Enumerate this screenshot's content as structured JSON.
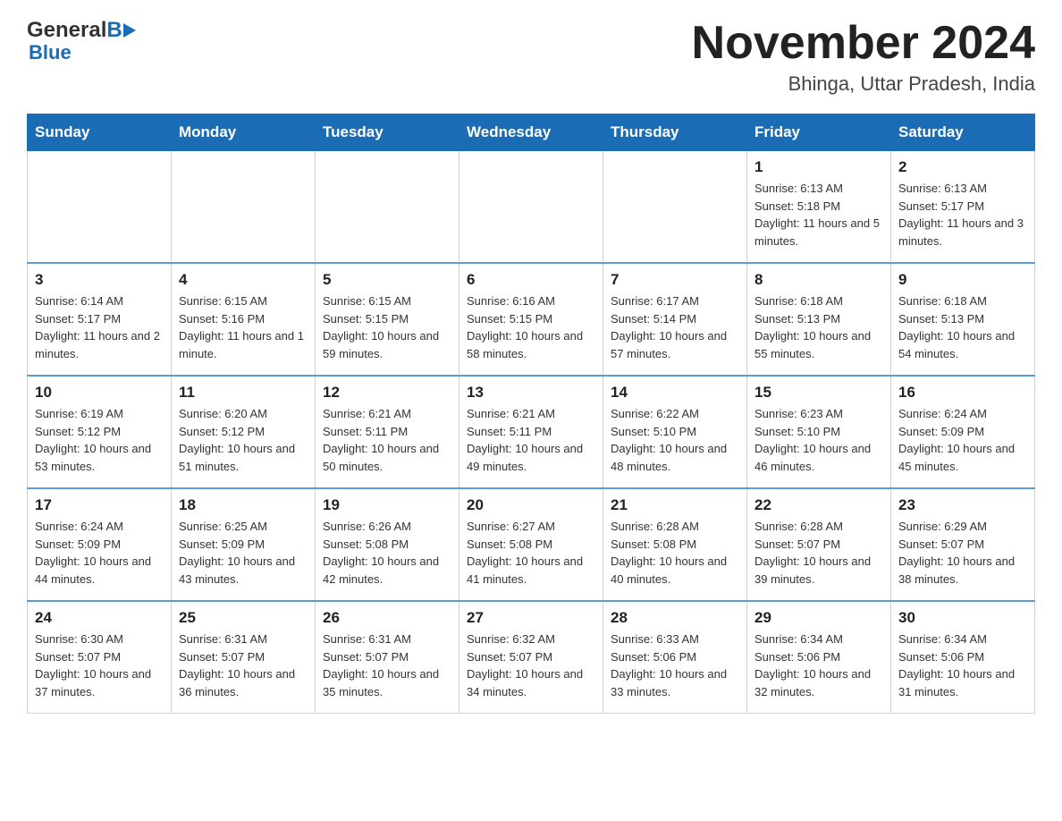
{
  "header": {
    "logo": {
      "general": "General",
      "blue": "Blue"
    },
    "title": "November 2024",
    "location": "Bhinga, Uttar Pradesh, India"
  },
  "calendar": {
    "days_of_week": [
      "Sunday",
      "Monday",
      "Tuesday",
      "Wednesday",
      "Thursday",
      "Friday",
      "Saturday"
    ],
    "weeks": [
      [
        {
          "day": "",
          "info": ""
        },
        {
          "day": "",
          "info": ""
        },
        {
          "day": "",
          "info": ""
        },
        {
          "day": "",
          "info": ""
        },
        {
          "day": "",
          "info": ""
        },
        {
          "day": "1",
          "info": "Sunrise: 6:13 AM\nSunset: 5:18 PM\nDaylight: 11 hours and 5 minutes."
        },
        {
          "day": "2",
          "info": "Sunrise: 6:13 AM\nSunset: 5:17 PM\nDaylight: 11 hours and 3 minutes."
        }
      ],
      [
        {
          "day": "3",
          "info": "Sunrise: 6:14 AM\nSunset: 5:17 PM\nDaylight: 11 hours and 2 minutes."
        },
        {
          "day": "4",
          "info": "Sunrise: 6:15 AM\nSunset: 5:16 PM\nDaylight: 11 hours and 1 minute."
        },
        {
          "day": "5",
          "info": "Sunrise: 6:15 AM\nSunset: 5:15 PM\nDaylight: 10 hours and 59 minutes."
        },
        {
          "day": "6",
          "info": "Sunrise: 6:16 AM\nSunset: 5:15 PM\nDaylight: 10 hours and 58 minutes."
        },
        {
          "day": "7",
          "info": "Sunrise: 6:17 AM\nSunset: 5:14 PM\nDaylight: 10 hours and 57 minutes."
        },
        {
          "day": "8",
          "info": "Sunrise: 6:18 AM\nSunset: 5:13 PM\nDaylight: 10 hours and 55 minutes."
        },
        {
          "day": "9",
          "info": "Sunrise: 6:18 AM\nSunset: 5:13 PM\nDaylight: 10 hours and 54 minutes."
        }
      ],
      [
        {
          "day": "10",
          "info": "Sunrise: 6:19 AM\nSunset: 5:12 PM\nDaylight: 10 hours and 53 minutes."
        },
        {
          "day": "11",
          "info": "Sunrise: 6:20 AM\nSunset: 5:12 PM\nDaylight: 10 hours and 51 minutes."
        },
        {
          "day": "12",
          "info": "Sunrise: 6:21 AM\nSunset: 5:11 PM\nDaylight: 10 hours and 50 minutes."
        },
        {
          "day": "13",
          "info": "Sunrise: 6:21 AM\nSunset: 5:11 PM\nDaylight: 10 hours and 49 minutes."
        },
        {
          "day": "14",
          "info": "Sunrise: 6:22 AM\nSunset: 5:10 PM\nDaylight: 10 hours and 48 minutes."
        },
        {
          "day": "15",
          "info": "Sunrise: 6:23 AM\nSunset: 5:10 PM\nDaylight: 10 hours and 46 minutes."
        },
        {
          "day": "16",
          "info": "Sunrise: 6:24 AM\nSunset: 5:09 PM\nDaylight: 10 hours and 45 minutes."
        }
      ],
      [
        {
          "day": "17",
          "info": "Sunrise: 6:24 AM\nSunset: 5:09 PM\nDaylight: 10 hours and 44 minutes."
        },
        {
          "day": "18",
          "info": "Sunrise: 6:25 AM\nSunset: 5:09 PM\nDaylight: 10 hours and 43 minutes."
        },
        {
          "day": "19",
          "info": "Sunrise: 6:26 AM\nSunset: 5:08 PM\nDaylight: 10 hours and 42 minutes."
        },
        {
          "day": "20",
          "info": "Sunrise: 6:27 AM\nSunset: 5:08 PM\nDaylight: 10 hours and 41 minutes."
        },
        {
          "day": "21",
          "info": "Sunrise: 6:28 AM\nSunset: 5:08 PM\nDaylight: 10 hours and 40 minutes."
        },
        {
          "day": "22",
          "info": "Sunrise: 6:28 AM\nSunset: 5:07 PM\nDaylight: 10 hours and 39 minutes."
        },
        {
          "day": "23",
          "info": "Sunrise: 6:29 AM\nSunset: 5:07 PM\nDaylight: 10 hours and 38 minutes."
        }
      ],
      [
        {
          "day": "24",
          "info": "Sunrise: 6:30 AM\nSunset: 5:07 PM\nDaylight: 10 hours and 37 minutes."
        },
        {
          "day": "25",
          "info": "Sunrise: 6:31 AM\nSunset: 5:07 PM\nDaylight: 10 hours and 36 minutes."
        },
        {
          "day": "26",
          "info": "Sunrise: 6:31 AM\nSunset: 5:07 PM\nDaylight: 10 hours and 35 minutes."
        },
        {
          "day": "27",
          "info": "Sunrise: 6:32 AM\nSunset: 5:07 PM\nDaylight: 10 hours and 34 minutes."
        },
        {
          "day": "28",
          "info": "Sunrise: 6:33 AM\nSunset: 5:06 PM\nDaylight: 10 hours and 33 minutes."
        },
        {
          "day": "29",
          "info": "Sunrise: 6:34 AM\nSunset: 5:06 PM\nDaylight: 10 hours and 32 minutes."
        },
        {
          "day": "30",
          "info": "Sunrise: 6:34 AM\nSunset: 5:06 PM\nDaylight: 10 hours and 31 minutes."
        }
      ]
    ]
  }
}
